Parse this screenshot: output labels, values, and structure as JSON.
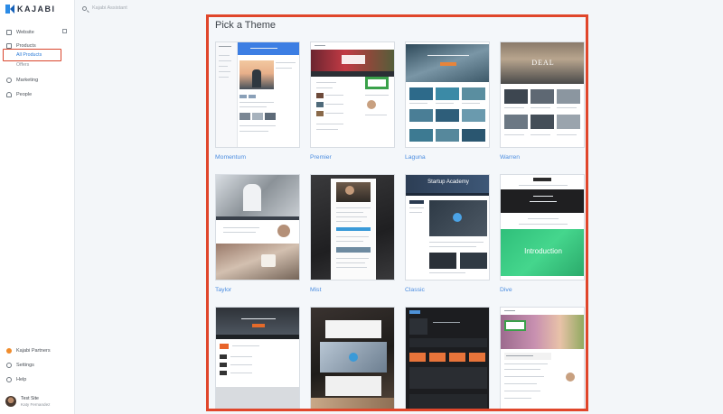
{
  "app": {
    "logo_text": "KAJABI"
  },
  "search": {
    "placeholder": "Kajabi Assistant"
  },
  "sidebar": {
    "items": [
      {
        "label": "Website",
        "icon": "monitor-icon"
      },
      {
        "label": "Products",
        "icon": "folder-icon"
      },
      {
        "label": "Marketing",
        "icon": "megaphone-icon"
      },
      {
        "label": "People",
        "icon": "person-icon"
      }
    ],
    "sub_items": [
      {
        "label": "All Products",
        "state": "active"
      },
      {
        "label": "Offers",
        "state": "inactive"
      }
    ],
    "bottom_items": [
      {
        "label": "Kajabi Partners",
        "icon": "partner-icon"
      },
      {
        "label": "Settings",
        "icon": "gear-icon"
      },
      {
        "label": "Help",
        "icon": "help-icon"
      }
    ],
    "user": {
      "site": "Test Site",
      "name": "Katy Fernandez"
    }
  },
  "main": {
    "title": "Pick a Theme",
    "themes": [
      {
        "name": "Momentum"
      },
      {
        "name": "Premier"
      },
      {
        "name": "Laguna"
      },
      {
        "name": "Warren"
      },
      {
        "name": "Taylor"
      },
      {
        "name": "Mist"
      },
      {
        "name": "Classic"
      },
      {
        "name": "Dive"
      },
      {
        "name": ""
      },
      {
        "name": ""
      },
      {
        "name": ""
      },
      {
        "name": ""
      }
    ],
    "thumb_text": {
      "warren_hero": "DEAL",
      "classic_hero": "Startup Academy",
      "dive_hero": "Introduction"
    }
  },
  "colors": {
    "accent": "#2b7bd8",
    "highlight": "#e0462b",
    "theme_label": "#4b8de0"
  }
}
